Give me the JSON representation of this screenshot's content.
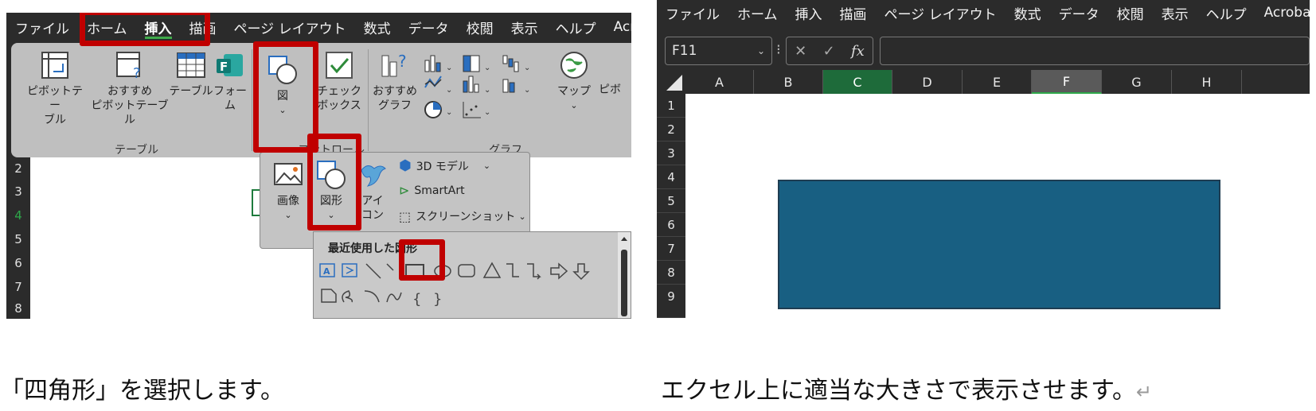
{
  "left": {
    "menu": [
      "ファイル",
      "ホーム",
      "挿入",
      "描画",
      "ページ レイアウト",
      "数式",
      "データ",
      "校閲",
      "表示",
      "ヘルプ",
      "Acrob"
    ],
    "active_menu": "挿入",
    "ribbon": {
      "pivot_table": "ピボットテー\nブル",
      "recommended_pivot": "おすすめ\nピボットテーブル",
      "table": "テーブル",
      "forms": "フォー\nム",
      "illustrations": "図",
      "checkbox": "チェック\nボックス",
      "recommended_chart": "おすすめ\nグラフ",
      "map": "マップ",
      "pivot_chart_partial": "ピボ",
      "group_table": "テーブル",
      "group_controls": "コントロール",
      "group_charts": "グラフ"
    },
    "rows": [
      "2",
      "3",
      "4",
      "5",
      "6",
      "7",
      "8"
    ],
    "dropdown": {
      "image": "画像",
      "shapes": "図形",
      "icons": "アイ\nコン",
      "model3d": "3D モデル",
      "smartart": "SmartArt",
      "screenshot": "スクリーンショット"
    },
    "gallery": {
      "title": "最近使用した図形"
    }
  },
  "right": {
    "menu": [
      "ファイル",
      "ホーム",
      "挿入",
      "描画",
      "ページ レイアウト",
      "数式",
      "データ",
      "校閲",
      "表示",
      "ヘルプ",
      "Acrobat"
    ],
    "name_box": "F11",
    "fx": "fx",
    "columns": [
      "A",
      "B",
      "C",
      "D",
      "E",
      "F",
      "G",
      "H"
    ],
    "rows": [
      "1",
      "2",
      "3",
      "4",
      "5",
      "6",
      "7",
      "8",
      "9"
    ],
    "shape_fill": "#185f82"
  },
  "captions": {
    "left": "「四角形」を選択します。",
    "right": "エクセル上に適当な大きさで表示させます。",
    "return_mark": "↵"
  },
  "colors": {
    "highlight": "#c00000",
    "accent_green": "#2ea84a",
    "dark_bg": "#2b2b2b"
  }
}
